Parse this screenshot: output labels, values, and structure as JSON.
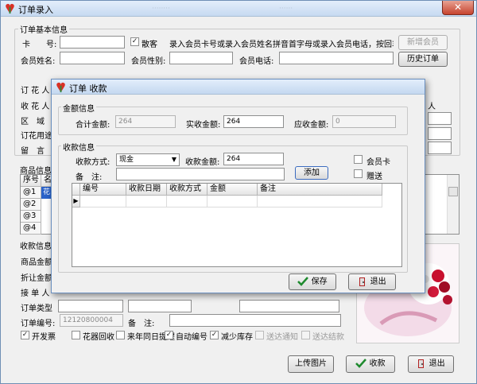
{
  "window": {
    "title": "订单录入",
    "close": "✕"
  },
  "basic": {
    "legend": "订单基本信息",
    "card_label": "卡　　号:",
    "walkin_label": "散客",
    "walkin_checked": true,
    "hint": "录入会员卡号或录入会员姓名拼音首字母或录入会员电话，按回车...",
    "new_member": "新增会员",
    "history": "历史订单",
    "name_label": "会员姓名:",
    "gender_label": "会员性别:",
    "phone_label": "会员电话:",
    "side_labels": [
      "订 花 人",
      "收 花 人",
      "区　域",
      "订花用途",
      "留　言"
    ]
  },
  "goods": {
    "legend": "商品信息",
    "cols": [
      "序号",
      "名"
    ],
    "rows": [
      "@1",
      "@2",
      "@3",
      "@4"
    ],
    "row1_sel": "花"
  },
  "payinfo": {
    "legend": "收款信息",
    "labels": [
      "商品金额",
      "折让金额",
      "接 单 人",
      "订单类型"
    ],
    "order_no_label": "订单编号:",
    "order_no": "12120800004",
    "remark_label": "备　注:",
    "checks": [
      {
        "label": "开发票",
        "checked": true,
        "disabled": false
      },
      {
        "label": "花器回收",
        "checked": false,
        "disabled": false
      },
      {
        "label": "来年同日提醒",
        "checked": false,
        "disabled": false
      },
      {
        "label": "自动编号",
        "checked": true,
        "disabled": false
      },
      {
        "label": "减少库存",
        "checked": true,
        "disabled": false
      },
      {
        "label": "送达通知",
        "checked": false,
        "disabled": true
      },
      {
        "label": "送达结款",
        "checked": false,
        "disabled": true
      }
    ]
  },
  "buttons": {
    "upload": "上传图片",
    "collect": "收款",
    "exit": "退出"
  },
  "dialog": {
    "title": "订单 收款",
    "amount_legend": "金额信息",
    "total_label": "合计金额:",
    "total": "264",
    "actual_label": "实收金额:",
    "actual": "264",
    "due_label": "应收金额:",
    "due": "0",
    "collect_legend": "收款信息",
    "method_label": "收款方式:",
    "method": "现金",
    "received_label": "收款金额:",
    "received": "264",
    "member_card": "会员卡",
    "gift": "赠送",
    "remark_label": "备　注:",
    "add": "添加",
    "cols": [
      "编号",
      "收款日期",
      "收款方式",
      "金额",
      "备注"
    ],
    "save": "保存",
    "exit": "退出"
  },
  "colors": {
    "ok_green": "#1e8a2e",
    "exit_red": "#b22222",
    "accent_blue": "#2a62c9"
  }
}
